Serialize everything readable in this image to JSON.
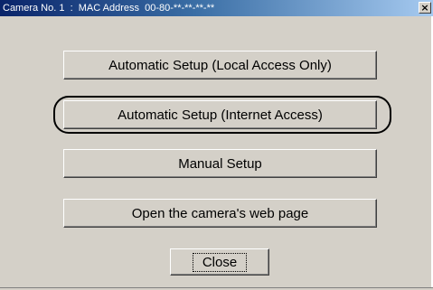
{
  "window": {
    "title": "Camera No. 1  :  MAC Address  00-80-**-**-**-**",
    "close_glyph": "×"
  },
  "buttons": {
    "auto_local": "Automatic Setup (Local Access Only)",
    "auto_internet": "Automatic Setup (Internet Access)",
    "manual": "Manual Setup",
    "open_web": "Open the camera's web page",
    "close": "Close"
  },
  "colors": {
    "dialog_face": "#d4d0c8",
    "titlebar_start": "#0a246a",
    "titlebar_end": "#a6caf0",
    "highlight_ring": "#000000"
  }
}
